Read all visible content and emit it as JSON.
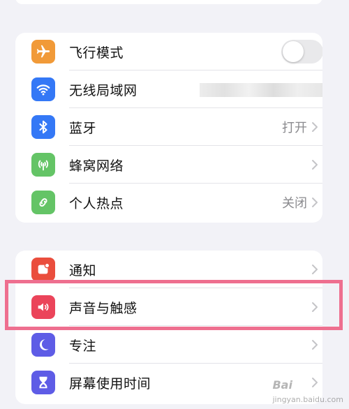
{
  "settings": {
    "group1": [
      {
        "label": "飞行模式",
        "icon": "airplane-icon",
        "icon_color": "#f19a38",
        "control": "toggle",
        "toggle_on": false
      },
      {
        "label": "无线局域网",
        "icon": "wifi-icon",
        "icon_color": "#3478f6",
        "control": "blurred"
      },
      {
        "label": "蓝牙",
        "icon": "bluetooth-icon",
        "icon_color": "#3478f6",
        "value": "打开"
      },
      {
        "label": "蜂窝网络",
        "icon": "cellular-icon",
        "icon_color": "#64c466"
      },
      {
        "label": "个人热点",
        "icon": "hotspot-icon",
        "icon_color": "#64c466",
        "value": "关闭"
      }
    ],
    "group2": [
      {
        "label": "通知",
        "icon": "bell-icon",
        "icon_color": "#ea4e3d"
      },
      {
        "label": "声音与触感",
        "icon": "speaker-icon",
        "icon_color": "#eb445a"
      },
      {
        "label": "专注",
        "icon": "moon-icon",
        "icon_color": "#5e5ce6"
      },
      {
        "label": "屏幕使用时间",
        "icon": "hourglass-icon",
        "icon_color": "#5e5ce6"
      }
    ]
  },
  "highlight_color": "#ee6f8f",
  "watermark": {
    "brand": "Bai",
    "sub": "jingyan.baidu.com"
  }
}
